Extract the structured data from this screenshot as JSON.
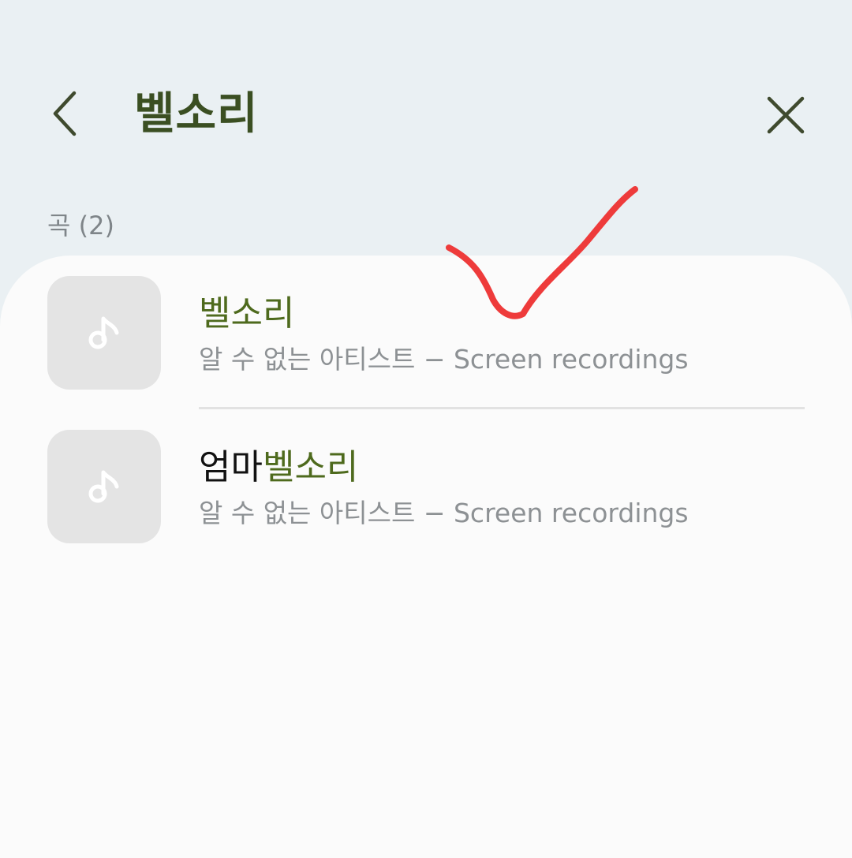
{
  "header": {
    "title": "벨소리",
    "back_icon": "chevron-left-icon",
    "close_icon": "close-icon"
  },
  "section": {
    "label": "곡 (2)"
  },
  "songs": [
    {
      "title_prefix": "",
      "title_match": "벨소리",
      "subtitle": "알 수 없는 아티스트 − Screen recordings",
      "icon": "music-note-icon"
    },
    {
      "title_prefix": "엄마",
      "title_match": "벨소리",
      "subtitle": "알 수 없는 아티스트 − Screen recordings",
      "icon": "music-note-icon"
    }
  ],
  "colors": {
    "background": "#eaf0f3",
    "sheet": "#fbfbfb",
    "title": "#3b4f22",
    "highlight": "#4e6a1d",
    "annotation": "#ee3b3b"
  }
}
